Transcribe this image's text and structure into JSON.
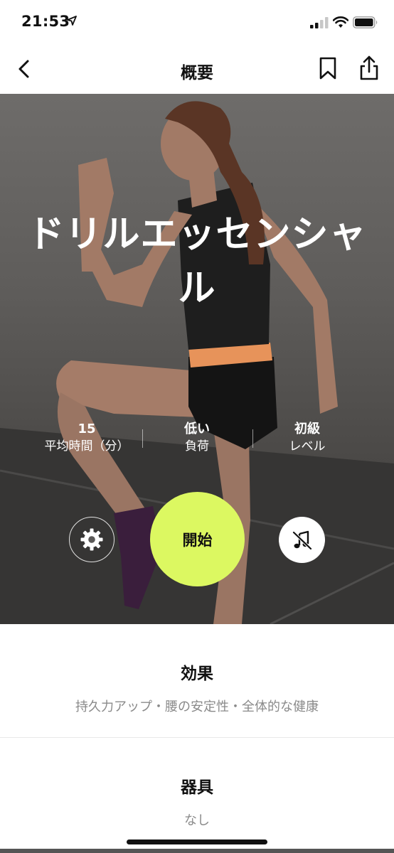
{
  "status_bar": {
    "time": "21:53"
  },
  "nav": {
    "title": "概要"
  },
  "hero": {
    "title": "ドリルエッセンシャル",
    "stats": [
      {
        "value": "15",
        "label": "平均時間（分）"
      },
      {
        "value": "低い",
        "label": "負荷"
      },
      {
        "value": "初級",
        "label": "レベル"
      }
    ],
    "start_label": "開始",
    "start_color": "#dcf861"
  },
  "benefits": {
    "title": "効果",
    "text": "持久力アップ・腰の安定性・全体的な健康"
  },
  "equipment": {
    "title": "器具",
    "text": "なし"
  },
  "icons": {
    "back": "chevron-left-icon",
    "bookmark": "bookmark-icon",
    "share": "share-icon",
    "settings": "gear-icon",
    "music": "music-off-icon"
  }
}
